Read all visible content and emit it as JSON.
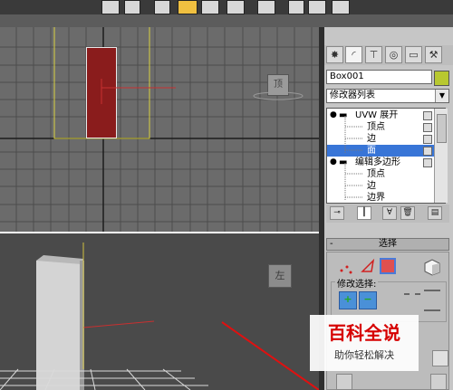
{
  "toolbar": {
    "icons": [
      "select-icon",
      "list-icon",
      "move-icon",
      "highlighted-tool-icon",
      "copy-icon",
      "layer-icon",
      "snap-icon",
      "magnet-icon",
      "percent-icon"
    ]
  },
  "viewports": {
    "top_cube_label": "顶",
    "persp_cube_label": "左"
  },
  "command_panel": {
    "tabs": [
      "create-icon",
      "modify-icon",
      "hierarchy-icon",
      "motion-icon",
      "display-icon",
      "utilities-icon"
    ],
    "object_name": "Box001",
    "object_color": "#b8c830",
    "modifier_list": "修改器列表",
    "stack": [
      {
        "label": "UVW 展开",
        "indent": 0,
        "selected": false,
        "bulb": true
      },
      {
        "label": "顶点",
        "indent": 2,
        "selected": false
      },
      {
        "label": "边",
        "indent": 2,
        "selected": false
      },
      {
        "label": "面",
        "indent": 2,
        "selected": true
      },
      {
        "label": "编辑多边形",
        "indent": 0,
        "selected": false,
        "bulb": true
      },
      {
        "label": "顶点",
        "indent": 2,
        "selected": false
      },
      {
        "label": "边",
        "indent": 2,
        "selected": false
      },
      {
        "label": "边界",
        "indent": 2,
        "selected": false
      }
    ],
    "rollout_title": "选择",
    "modify_selection_label": "修改选择:",
    "selection_color": "#e05050"
  },
  "watermark": {
    "title": "百科全说",
    "subtitle": "助你轻松解决"
  }
}
